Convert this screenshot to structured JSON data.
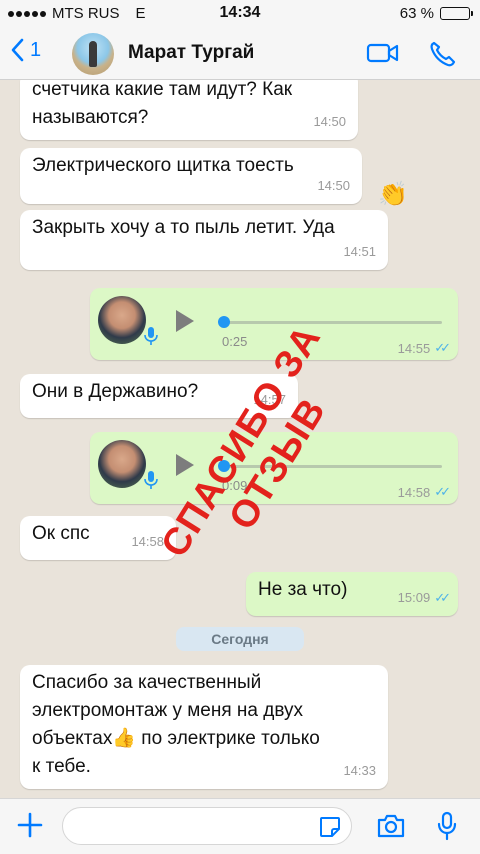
{
  "status_bar": {
    "carrier": "MTS RUS",
    "network": "E",
    "time": "14:34",
    "battery_text": "63 %",
    "battery_level": 0.63
  },
  "header": {
    "back_count": "1",
    "contact_name": "Марат Тургай"
  },
  "messages": [
    {
      "type": "text",
      "side": "in",
      "lines": [
        "счетчика какие там идут? Как",
        "называются?"
      ],
      "time": "14:50"
    },
    {
      "type": "text",
      "side": "in",
      "lines": [
        "Электрического щитка тоесть"
      ],
      "time": "14:50"
    },
    {
      "type": "text",
      "side": "in",
      "lines": [
        "Закрыть хочу а то пыль летит. Уда"
      ],
      "time": "14:51"
    },
    {
      "type": "voice",
      "side": "out",
      "duration": "0:25",
      "time": "14:55",
      "progress": 0.0
    },
    {
      "type": "text",
      "side": "in",
      "lines": [
        "Они в Державино?"
      ],
      "time": "14:57"
    },
    {
      "type": "voice",
      "side": "out",
      "duration": "0:09",
      "time": "14:58",
      "progress": 0.0
    },
    {
      "type": "text",
      "side": "in",
      "lines": [
        "Ок спс"
      ],
      "time": "14:58"
    },
    {
      "type": "text",
      "side": "out",
      "lines": [
        "Не за что)"
      ],
      "time": "15:09"
    },
    {
      "type": "text",
      "side": "in",
      "lines": [
        "Спасибо за качественный",
        "электромонтаж у меня на двух",
        "объектах👍 по электрике только",
        "к тебе."
      ],
      "time": "14:33"
    }
  ],
  "date_separator": "Сегодня",
  "overlay_stamp": "СПАСИБО ЗА ОТЗЫВ",
  "emoji_overlay": "👏",
  "input": {
    "placeholder": ""
  },
  "colors": {
    "accent": "#007aff",
    "outgoing_bubble": "#dcf8c6",
    "incoming_bubble": "#ffffff",
    "read_ticks": "#4fb3e8",
    "stamp": "#e3221c"
  },
  "icons": [
    "back-chevron-icon",
    "video-call-icon",
    "phone-icon",
    "play-icon",
    "mic-icon",
    "plus-icon",
    "sticker-icon",
    "camera-icon"
  ]
}
